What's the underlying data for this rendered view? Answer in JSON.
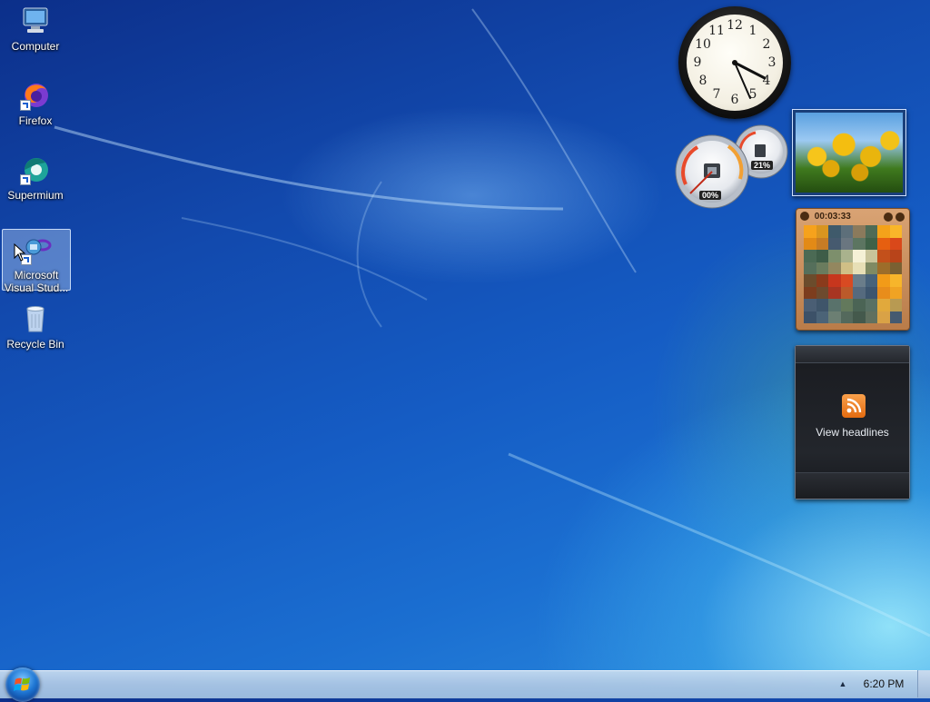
{
  "desktop": {
    "icons": [
      {
        "label_line1": "Computer"
      },
      {
        "label_line1": "Firefox"
      },
      {
        "label_line1": "Supermium"
      },
      {
        "label_line1": "Microsoft",
        "label_line2": "Visual Stud..."
      },
      {
        "label_line1": "Recycle Bin"
      }
    ]
  },
  "gadgets": {
    "clock": {
      "numbers": [
        "12",
        "1",
        "2",
        "3",
        "4",
        "5",
        "6",
        "7",
        "8",
        "9",
        "10",
        "11"
      ],
      "time_shown": "4:20"
    },
    "cpu_meter": {
      "cpu_percent": "00%",
      "memory_percent": "21%"
    },
    "slideshow": {
      "subject": "yellow tulips"
    },
    "puzzle": {
      "timer": "00:03:33"
    },
    "feed_headlines": {
      "label": "View headlines"
    }
  },
  "taskbar": {
    "clock_text": "6:20 PM",
    "tray_arrow": "▲"
  },
  "colors": {
    "desktop_blue": "#155cc4",
    "taskbar": "#b8d0ea",
    "selection": "#aac8f0"
  }
}
